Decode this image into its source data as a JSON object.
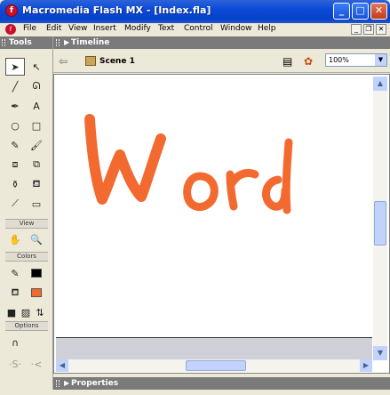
{
  "window": {
    "title": "Macromedia Flash MX - [Index.fla]",
    "app_icon": "flash-icon",
    "buttons": {
      "minimize": "_",
      "maximize": "□",
      "close": "✕"
    }
  },
  "menu": {
    "items": [
      {
        "label": "File"
      },
      {
        "label": "Edit"
      },
      {
        "label": "View"
      },
      {
        "label": "Insert"
      },
      {
        "label": "Modify"
      },
      {
        "label": "Text"
      },
      {
        "label": "Control"
      },
      {
        "label": "Window"
      },
      {
        "label": "Help"
      }
    ],
    "doc_buttons": {
      "minimize": "_",
      "restore": "❐",
      "close": "✕"
    }
  },
  "tools": {
    "header": "Tools",
    "view_label": "View",
    "colors_label": "Colors",
    "options_label": "Options",
    "icons": {
      "arrow": "➤",
      "subselect": "↖",
      "line": "╱",
      "lasso": "ᘏ",
      "pen": "✒",
      "text": "A",
      "oval": "○",
      "rect": "□",
      "pencil": "✎",
      "brush": "🖌",
      "free_transform": "⧈",
      "fill_transform": "⧉",
      "ink_bottle": "⚱",
      "paint_bucket": "⛾",
      "eyedropper": "⟋",
      "eraser": "▭",
      "hand": "✋",
      "zoom": "🔍",
      "stroke_pencil": "✎",
      "fill_bucket": "⛾",
      "default_colors": "■",
      "no_color": "▨",
      "swap_colors": "⇅",
      "magnet": "∩",
      "smooth": "·S·",
      "straighten": "·<"
    },
    "colors": {
      "stroke": "#000000",
      "fill": "#f26a30"
    }
  },
  "timeline": {
    "header": "Timeline"
  },
  "scene": {
    "label": "Scene 1",
    "zoom": "100%"
  },
  "stage": {
    "drawing_text": "Word",
    "drawing_color": "#f26a30"
  },
  "properties": {
    "header": "Properties"
  }
}
